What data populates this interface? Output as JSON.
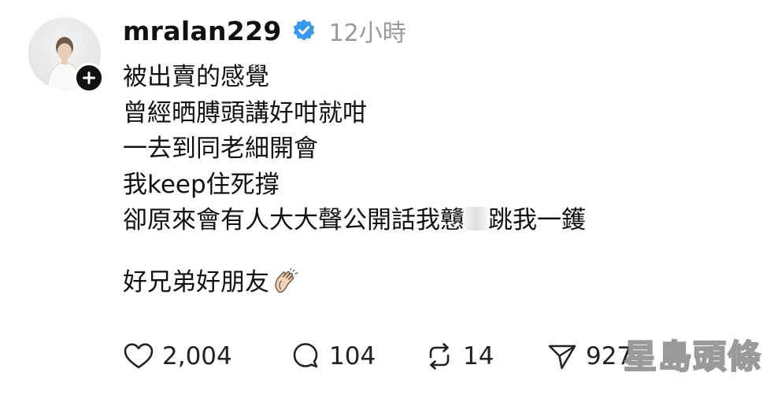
{
  "post": {
    "username": "mralan229",
    "verified": true,
    "time": "12小時",
    "lines": [
      "被出賣的感覺",
      "曾經晒膊頭講好咁就咁",
      "一去到同老細開會",
      "我keep住死撐"
    ],
    "line5_before": "卻原來會有人大大聲公開話我戇",
    "line5_after": "跳我一鑊",
    "line6": "好兄弟好朋友",
    "emoji": "clapping-hands"
  },
  "actions": {
    "likes": "2,004",
    "replies": "104",
    "reposts": "14",
    "shares": "927"
  },
  "watermark": "星島頭條",
  "colors": {
    "verified_badge": "#3897f0",
    "time_text": "#9a9a9a",
    "text": "#111111"
  }
}
